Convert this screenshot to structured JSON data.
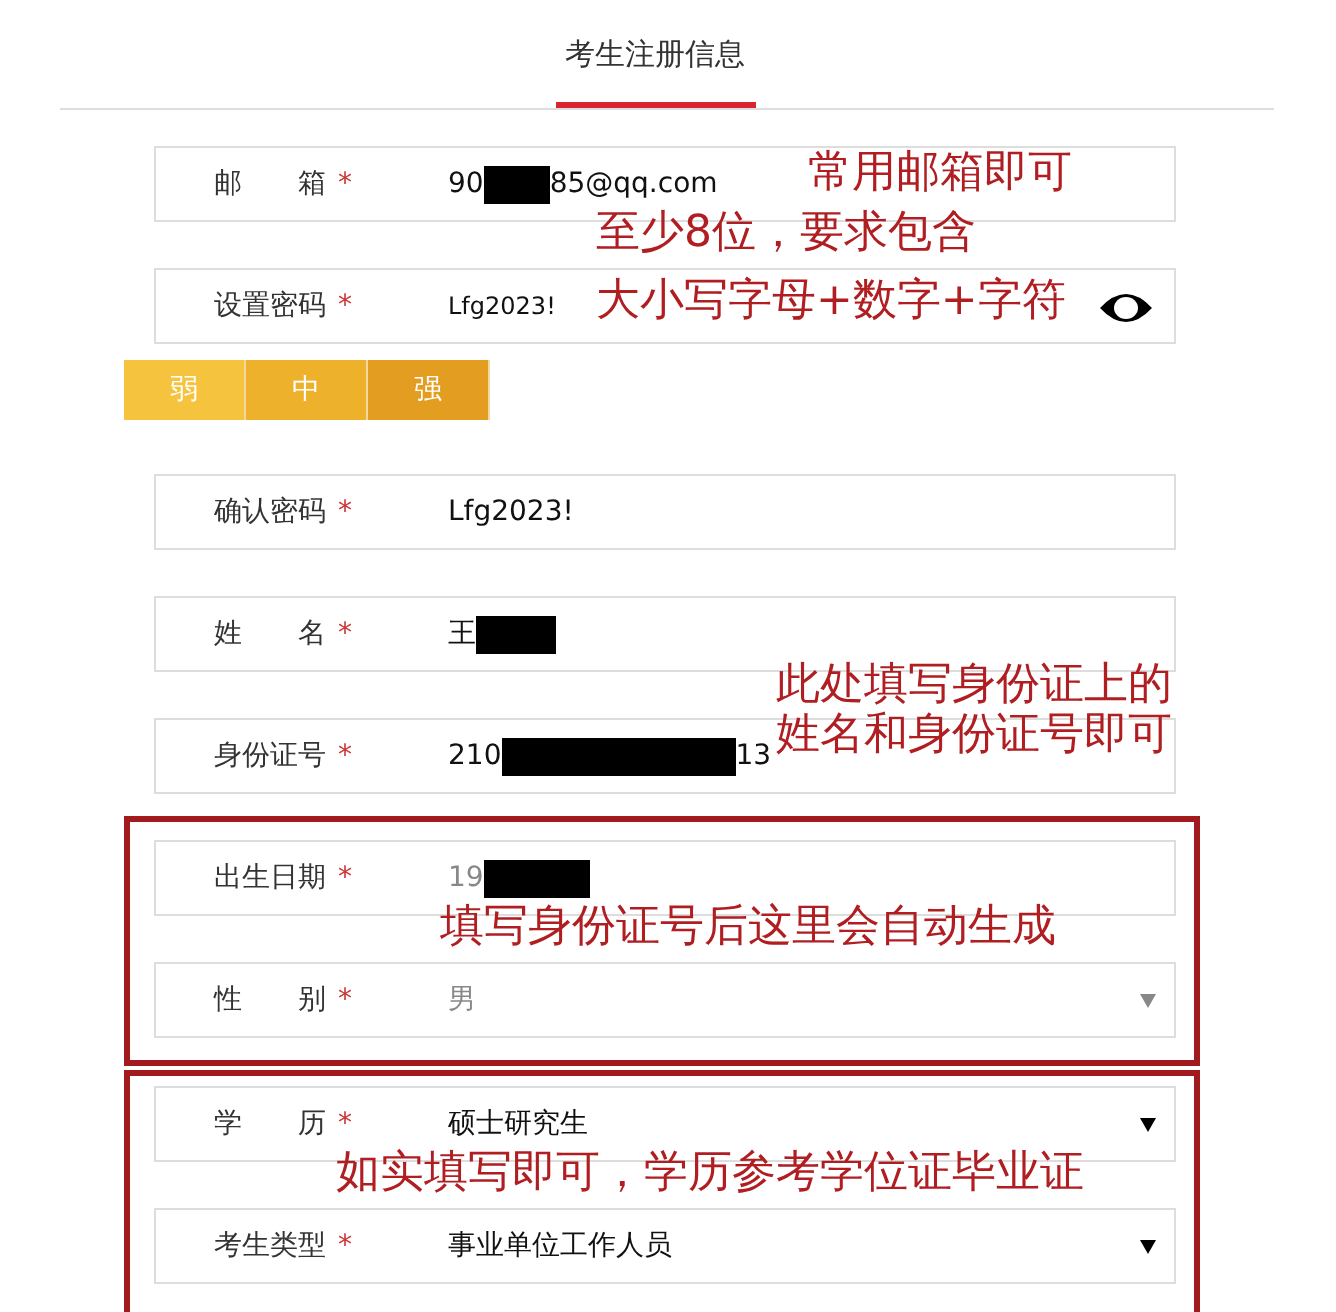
{
  "header": {
    "title": "考生注册信息",
    "selected": true
  },
  "groups": [
    {
      "outlined": false,
      "fields": [
        {
          "kind": "text",
          "label": "邮箱",
          "required": "*",
          "value": "90",
          "value_end": "85@qq.com",
          "redacted": true,
          "disabled": false
        },
        {
          "kind": "password",
          "label": "设置密码",
          "required": "*",
          "value": "Lfg2023!",
          "redacted": false,
          "disabled": false,
          "strength": [
            {
              "label": "弱",
              "color": "#f6c33f"
            },
            {
              "label": "中",
              "color": "#edb12c"
            },
            {
              "label": "强",
              "color": "#e39e22"
            }
          ]
        },
        {
          "kind": "text",
          "label": "确认密码",
          "required": "*",
          "value": "Lfg2023!",
          "redacted": false,
          "disabled": false
        },
        {
          "kind": "text",
          "label": "姓名",
          "required": "*",
          "value": "王",
          "redacted": true,
          "disabled": false
        },
        {
          "kind": "text",
          "label": "身份证号",
          "required": "*",
          "value": "210",
          "value_end": "13",
          "redacted": true,
          "disabled": false
        }
      ]
    },
    {
      "outlined": true,
      "fields": [
        {
          "kind": "text",
          "label": "出生日期",
          "required": "*",
          "value": "19",
          "redacted": true,
          "disabled": true
        },
        {
          "kind": "select",
          "label": "性别",
          "required": "*",
          "value": "男",
          "redacted": false,
          "disabled": true
        }
      ]
    },
    {
      "outlined": true,
      "fields": [
        {
          "kind": "select",
          "label": "学历",
          "required": "*",
          "value": "硕士研究生",
          "redacted": false,
          "disabled": false
        },
        {
          "kind": "select",
          "label": "考生类型",
          "required": "*",
          "value": "事业单位工作人员",
          "redacted": false,
          "disabled": false
        }
      ]
    }
  ],
  "annotations": [
    {
      "lines": [
        "常用邮箱即可"
      ]
    },
    {
      "lines": [
        "至少8位，要求包含",
        "大小写字母+数字+字符"
      ]
    },
    {
      "lines": [
        "此处填写身份证上的",
        "姓名和身份证号即可"
      ]
    },
    {
      "lines": [
        "填写身份证号后这里会自动生成"
      ]
    },
    {
      "lines": [
        "如实填写即可，学历参考学位证毕业证"
      ]
    }
  ]
}
